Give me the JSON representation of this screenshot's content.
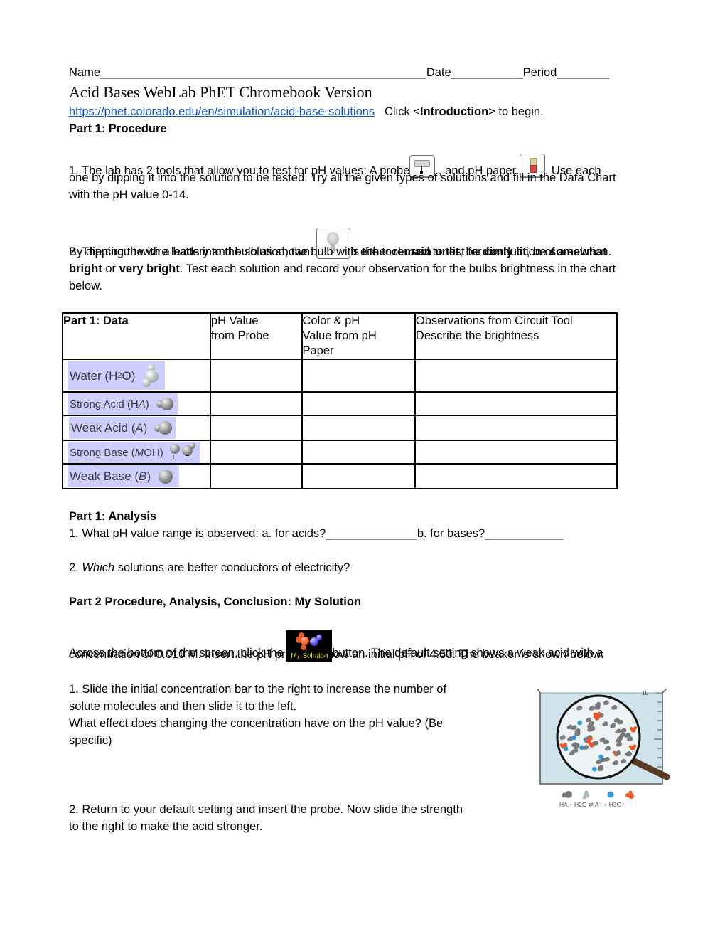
{
  "header": {
    "name_label": "Name__________________________________________________",
    "date_label": "Date___________",
    "period_label": "Period________"
  },
  "title": "Acid Bases WebLab PhET Chromebook Version",
  "intro": {
    "link_text": "https://phet.colorado.edu/en/simulation/acid-base-solutions",
    "click_prefix": "Click <",
    "click_bold": "Introduction",
    "click_suffix": "> to begin."
  },
  "part1_procedure": {
    "heading": "Part 1: Procedure",
    "step1": {
      "a": "1. The lab has 2 tools that allow you to test for pH values:  A probe",
      "b": " , and pH paper ",
      "c": ".  Use each",
      "line2": "one by dipping it into the solution to be tested.  Try all the given types of solutions and fill in the Data Chart",
      "line3": "with the pH value 0-14.",
      "probe_icon": "ph-probe-icon",
      "paper_icon": "ph-paper-icon"
    },
    "step2": {
      "a": "2.  The circuit with a battery and bulb as shown: ",
      "b": "is the tool used to test for conduction of a solution.",
      "line2_a": "By dipping the wire leads into the solution, the bulb with either ",
      "line2_b1": "remain unlit",
      "line2_c": ", be ",
      "line2_b2": "dimly lit",
      "line2_d": ", be ",
      "line2_b3": "somewhat",
      "line3_b": "bright",
      "line3_a": " or ",
      "line3_b2": "very bright",
      "line3_c": ".  Test each solution and record your observation for the bulbs brightness in the chart",
      "line4": "below.",
      "bulb_icon": "light-bulb-icon"
    }
  },
  "data_table": {
    "headers": [
      "Part 1: Data",
      "pH Value from Probe",
      "Color & pH Value from pH Paper",
      "Observations from Circuit Tool Describe the brightness"
    ],
    "header_lines": [
      [
        "Part 1: Data"
      ],
      [
        "pH Value",
        "from Probe"
      ],
      [
        "Color & pH",
        "Value from pH",
        "Paper"
      ],
      [
        "Observations from Circuit Tool",
        "Describe the brightness"
      ]
    ],
    "rows": [
      {
        "label": "Water (H",
        "sub": "2",
        "label_end": "O)",
        "probe": "",
        "paper": "",
        "observation": ""
      },
      {
        "label": "Strong Acid (H",
        "italic": "A",
        "label_end": ")",
        "probe": "",
        "paper": "",
        "observation": ""
      },
      {
        "label": "Weak Acid (",
        "italic": "A",
        "label_end": ")",
        "probe": "",
        "paper": "",
        "observation": ""
      },
      {
        "label": "Strong Base (",
        "italic": "M",
        "label_end": "OH)",
        "probe": "",
        "paper": "",
        "observation": ""
      },
      {
        "label": "Weak Base (",
        "italic": "B",
        "label_end": ")",
        "probe": "",
        "paper": "",
        "observation": ""
      }
    ]
  },
  "part1_analysis": {
    "heading": "Part 1: Analysis",
    "q1": "1. What pH value range is observed:  a. for acids?______________b. for bases?____________",
    "q2_a": "2. ",
    "q2_i": "Which",
    "q2_b": " solutions are better conductors of electricity?"
  },
  "part2": {
    "heading": "Part 2 Procedure, Analysis, Conclusion:  My Solution",
    "intro_a": "Across the bottom of the screen, click the ",
    "button_label": "My Solution",
    "intro_b": "button. The default setting shows a weak acid with a",
    "intro_line2": "concentration of 0.010 M. Insert the pH probe to show an initial pH of 4.50. The beaker is shown below:",
    "q1_lines": [
      "1. Slide the initial concentration bar to the right to increase the number of",
      "solute molecules and then slide it to the left.",
      "What effect does changing the concentration have on the pH value? (Be",
      "specific)"
    ],
    "q2_lines": [
      "2.  Return to your default setting and insert the probe.  Now slide the strength",
      "to the right to make the acid stronger."
    ],
    "beaker": {
      "volume_label": "1L",
      "equation": "HA + H2O ⇌ A⁻ + H3O⁺",
      "colors": {
        "water": "#cfe3ea",
        "ha": "#7a7a7a",
        "a_minus": "#2f9be0",
        "h3o": "#e8572a",
        "handle": "#5a3a22"
      }
    }
  }
}
